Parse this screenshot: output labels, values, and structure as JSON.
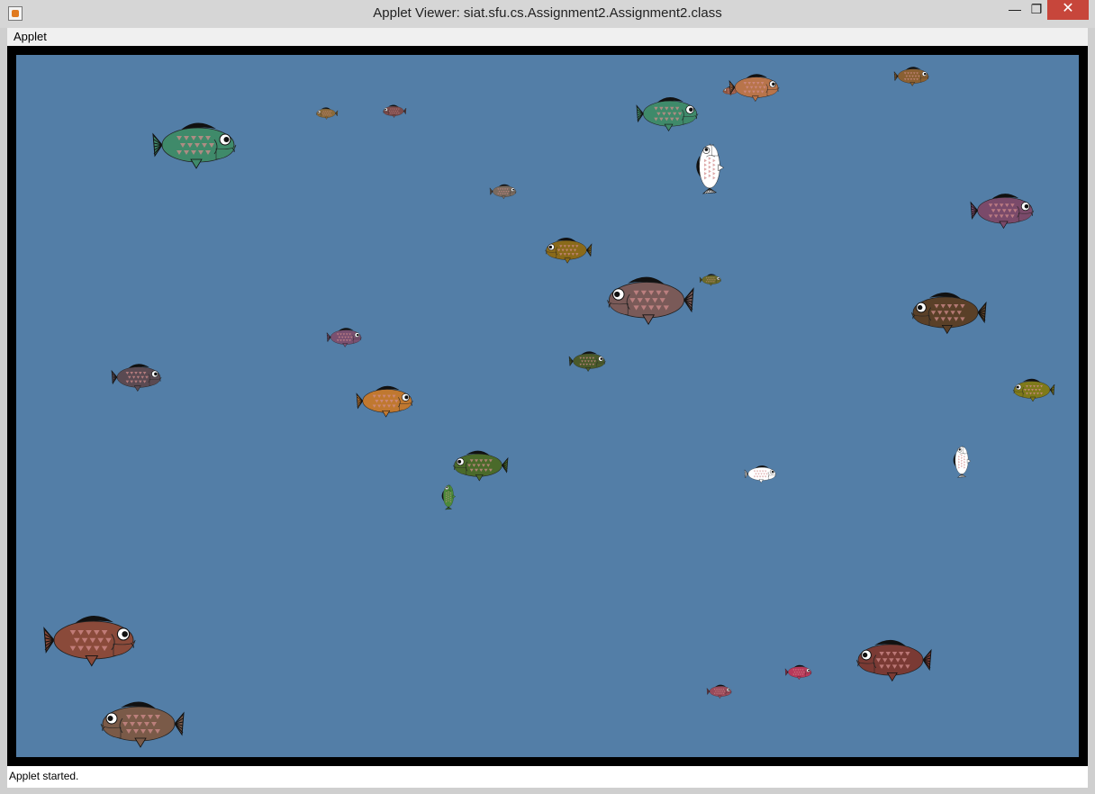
{
  "window": {
    "title": "Applet Viewer: siat.sfu.cs.Assignment2.Assignment2.class",
    "minimize_glyph": "—",
    "maximize_glyph": "❐",
    "close_glyph": "✕"
  },
  "menu": {
    "items": [
      "Applet"
    ]
  },
  "status": {
    "text": "Applet started."
  },
  "colors": {
    "water": "#537ea7",
    "border": "#000000",
    "scale_pattern": "#d28c8c"
  },
  "fish": [
    {
      "color": "#3f8a6a"
    },
    {
      "color": "#3f8a6a"
    },
    {
      "color": "#8a6032"
    },
    {
      "color": "#7a4a4a"
    },
    {
      "color": "#8a6a3a"
    },
    {
      "color": "#9a5a44"
    },
    {
      "color": "#7a6a5e"
    },
    {
      "color": "#ffffff"
    },
    {
      "color": "#7a5a58"
    },
    {
      "color": "#7a4a6a"
    },
    {
      "color": "#8a6a1a"
    },
    {
      "color": "#6a6a2a"
    },
    {
      "color": "#7a5070"
    },
    {
      "color": "#5a4028"
    },
    {
      "color": "#5a4a52"
    },
    {
      "color": "#4a5a2a"
    },
    {
      "color": "#4a6a2a"
    },
    {
      "color": "#c07830"
    },
    {
      "color": "#7f7a1a"
    },
    {
      "color": "#4c8a3a"
    },
    {
      "color": "#ffffff"
    },
    {
      "color": "#ffffff"
    },
    {
      "color": "#8a4a3a"
    },
    {
      "color": "#7a3a34"
    },
    {
      "color": "#b8385a"
    },
    {
      "color": "#9a4a5a"
    },
    {
      "color": "#7a5a48"
    },
    {
      "color": "#b8744a"
    }
  ]
}
